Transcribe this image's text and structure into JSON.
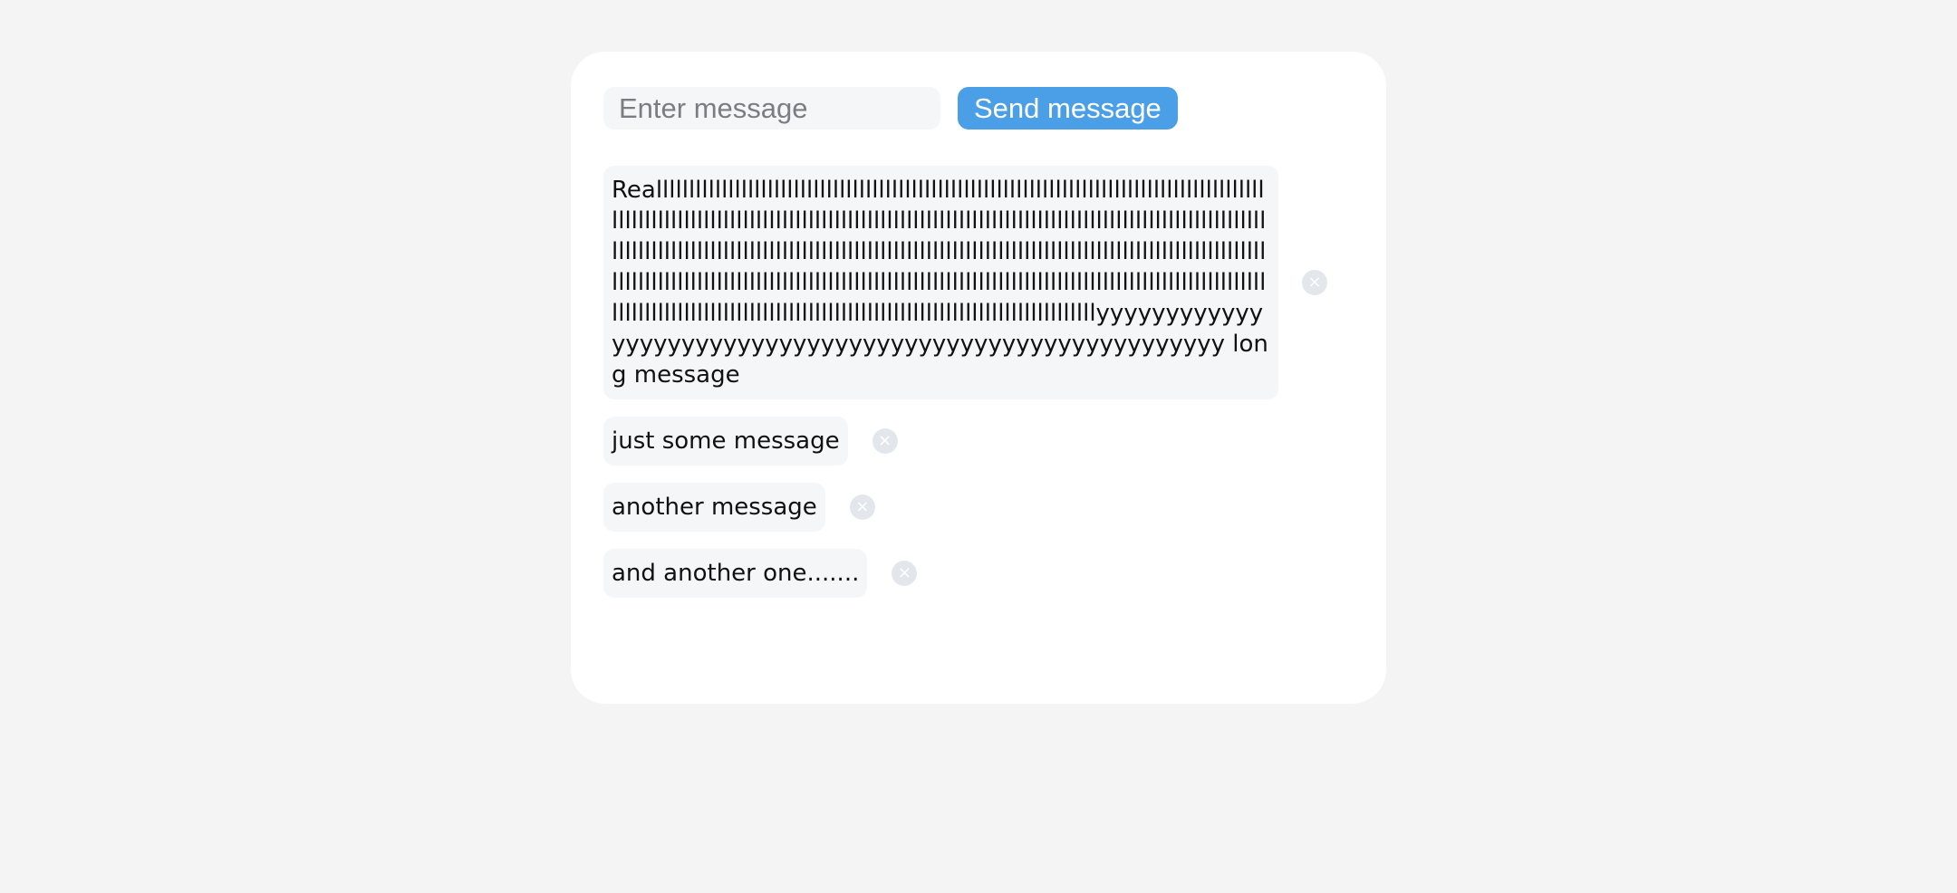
{
  "composer": {
    "placeholder": "Enter message",
    "value": "",
    "send_label": "Send message"
  },
  "messages": [
    {
      "text": "Realllllllllllllllllllllllllllllllllllllllllllllllllllllllllllllllllllllllllllllllllllllllllllllllllllllllllllllllllllllllllllllllllllllllllllllllllllllllllllllllllllllllllllllllllllllllllllllllllllllllllllllllllllllllllllllllllllllllllllllllllllllllllllllllllllllllllllllllllllllllllllllllllllllllllllllllllllllllllllllllllllllllllllllllllllllllllllllllllllllllllllllllllllllllllllllllllllllllllllllllllllllllllllllllllllllllllllllllllllllllllllllllllllllllllllllllllllyyyyyyyyyyyyyyyyyyyyyyyyyyyyyyyyyyyyyyyyyyyyyyyyyyyyyyyy long message"
    },
    {
      "text": "just some message"
    },
    {
      "text": "another message"
    },
    {
      "text": "and another one......."
    }
  ],
  "icons": {
    "delete": "close-icon",
    "delete_glyph": "×"
  },
  "colors": {
    "accent": "#4a9fe7",
    "bubble": "#f4f6f8",
    "background": "#f4f4f4",
    "card": "#ffffff",
    "delete_badge": "#e3e7ec"
  }
}
